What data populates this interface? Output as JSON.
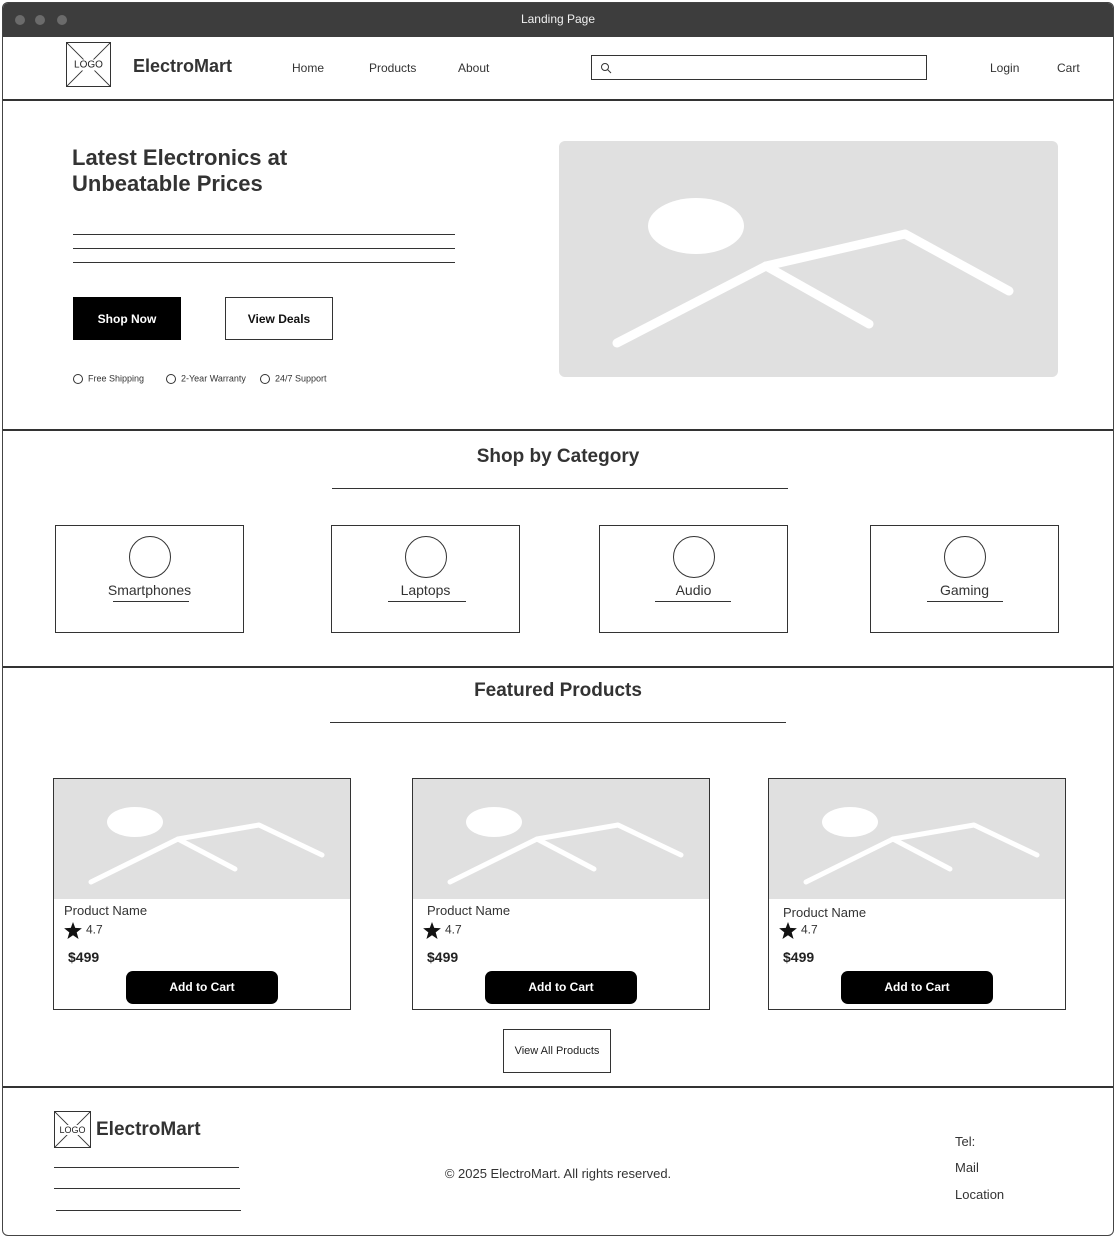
{
  "window": {
    "title": "Landing Page"
  },
  "header": {
    "logo_text": "LOGO",
    "brand": "ElectroMart",
    "nav": [
      "Home",
      "Products",
      "About"
    ],
    "search_placeholder": "",
    "login": "Login",
    "cart": "Cart"
  },
  "hero": {
    "title": "Latest Electronics at Unbeatable Prices",
    "shop_now": "Shop Now",
    "view_deals": "View Deals",
    "features": [
      "Free Shipping",
      "2-Year Warranty",
      "24/7 Support"
    ]
  },
  "categories": {
    "title": "Shop by Category",
    "items": [
      "Smartphones",
      "Laptops",
      "Audio",
      "Gaming"
    ]
  },
  "featured": {
    "title": "Featured Products",
    "products": [
      {
        "name": "Product Name",
        "rating": "4.7",
        "price": "$499",
        "button": "Add to Cart"
      },
      {
        "name": "Product Name",
        "rating": "4.7",
        "price": "$499",
        "button": "Add to Cart"
      },
      {
        "name": "Product Name",
        "rating": "4.7",
        "price": "$499",
        "button": "Add to Cart"
      }
    ],
    "view_all": "View All Products"
  },
  "footer": {
    "logo_text": "LOGO",
    "brand": "ElectroMart",
    "copyright": "© 2025 ElectroMart. All rights reserved.",
    "contact": [
      "Tel:",
      "Mail",
      "Location"
    ]
  },
  "colors": {
    "titlebar": "#3d3d3d",
    "placeholder_gray": "#e0e0e0",
    "primary_button": "#000000",
    "border": "#333333"
  }
}
